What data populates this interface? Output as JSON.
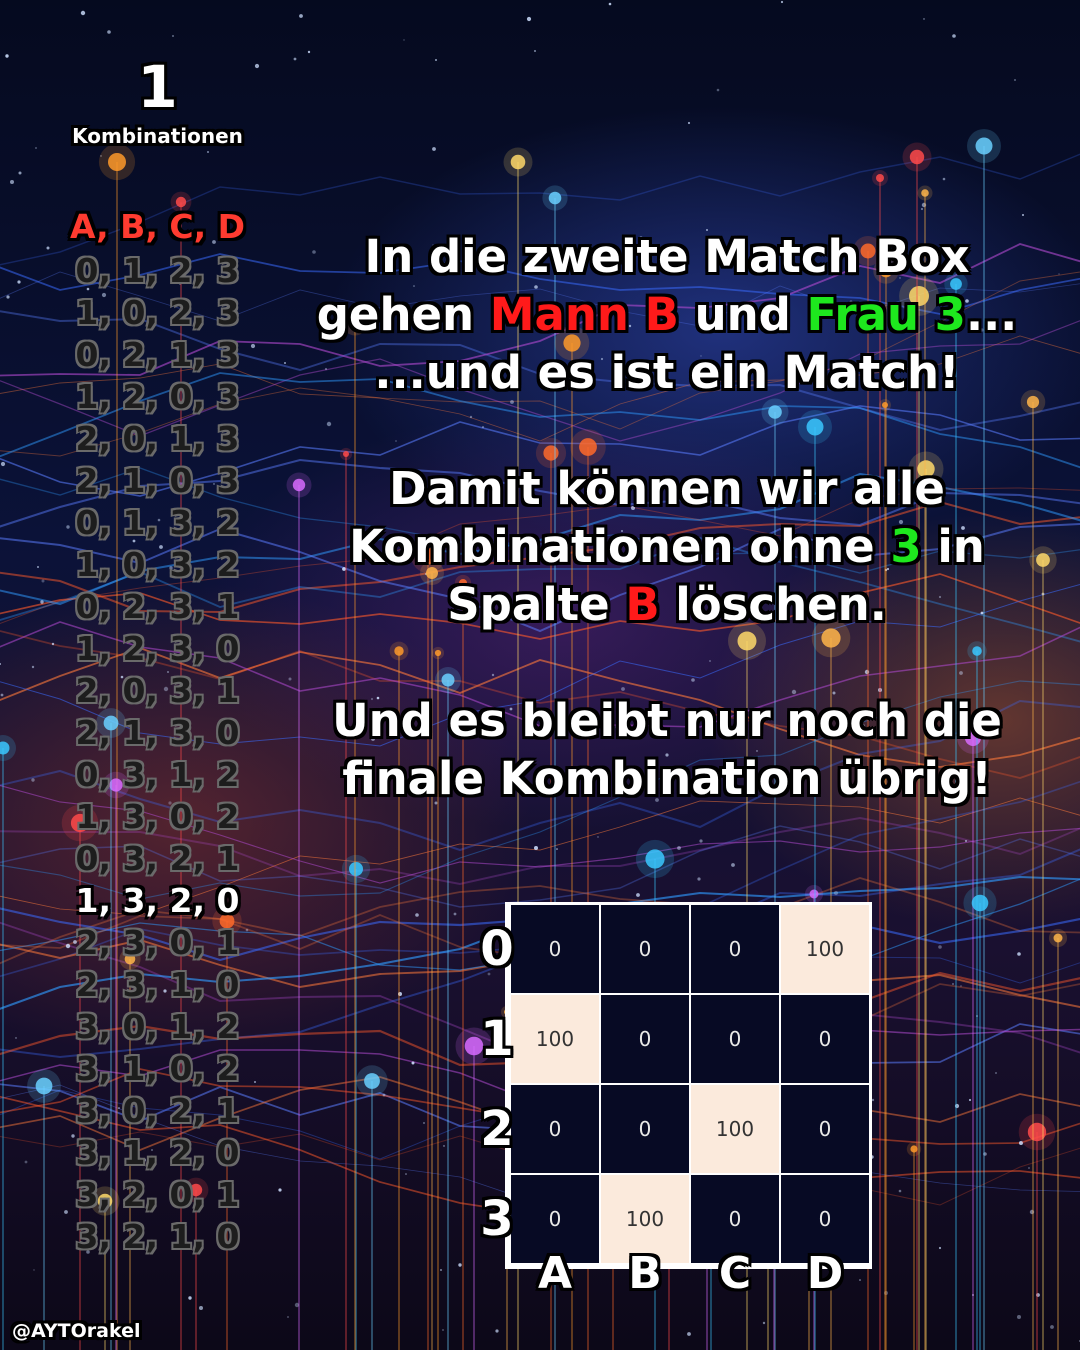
{
  "counter": {
    "value": "1",
    "label": "Kombinationen"
  },
  "combinations": {
    "header": "A, B, C, D",
    "items": [
      {
        "text": "0, 1, 2, 3",
        "remaining": false
      },
      {
        "text": "1, 0, 2, 3",
        "remaining": false
      },
      {
        "text": "0, 2, 1, 3",
        "remaining": false
      },
      {
        "text": "1, 2, 0, 3",
        "remaining": false
      },
      {
        "text": "2, 0, 1, 3",
        "remaining": false
      },
      {
        "text": "2, 1, 0, 3",
        "remaining": false
      },
      {
        "text": "0, 1, 3, 2",
        "remaining": false
      },
      {
        "text": "1, 0, 3, 2",
        "remaining": false
      },
      {
        "text": "0, 2, 3, 1",
        "remaining": false
      },
      {
        "text": "1, 2, 3, 0",
        "remaining": false
      },
      {
        "text": "2, 0, 3, 1",
        "remaining": false
      },
      {
        "text": "2, 1, 3, 0",
        "remaining": false
      },
      {
        "text": "0, 3, 1, 2",
        "remaining": false
      },
      {
        "text": "1, 3, 0, 2",
        "remaining": false
      },
      {
        "text": "0, 3, 2, 1",
        "remaining": false
      },
      {
        "text": "1, 3, 2, 0",
        "remaining": true
      },
      {
        "text": "2, 3, 0, 1",
        "remaining": false
      },
      {
        "text": "2, 3, 1, 0",
        "remaining": false
      },
      {
        "text": "3, 0, 1, 2",
        "remaining": false
      },
      {
        "text": "3, 1, 0, 2",
        "remaining": false
      },
      {
        "text": "3, 0, 2, 1",
        "remaining": false
      },
      {
        "text": "3, 1, 2, 0",
        "remaining": false
      },
      {
        "text": "3, 2, 0, 1",
        "remaining": false
      },
      {
        "text": "3, 2, 1, 0",
        "remaining": false
      }
    ]
  },
  "message": {
    "p1": {
      "l1": "In die zweite Match Box",
      "l2a": "gehen ",
      "l2b": "Mann B",
      "l2c": " und ",
      "l2d": "Frau 3",
      "l2e": "...",
      "l3": "...und es ist ein Match!"
    },
    "p2": {
      "l1": "Damit können wir alle",
      "l2a": "Kombinationen ohne ",
      "l2b": "3",
      "l2c": " in",
      "l3a": "Spalte ",
      "l3b": "B",
      "l3c": " löschen."
    },
    "p3": {
      "l1": "Und es bleibt nur noch die",
      "l2": "finale Kombination übrig!"
    }
  },
  "matrix": {
    "row_labels": [
      "0",
      "1",
      "2",
      "3"
    ],
    "col_labels": [
      "A",
      "B",
      "C",
      "D"
    ],
    "rows": [
      [
        "0",
        "0",
        "0",
        "100"
      ],
      [
        "100",
        "0",
        "0",
        "0"
      ],
      [
        "0",
        "0",
        "100",
        "0"
      ],
      [
        "0",
        "100",
        "0",
        "0"
      ]
    ],
    "highlight_color": "#fbeadc",
    "cell_color": "#070a24"
  },
  "colors": {
    "man": "#ff1a1a",
    "woman": "#1ee81e",
    "header": "#ff3b30"
  },
  "handle": "@AYTOrakel"
}
